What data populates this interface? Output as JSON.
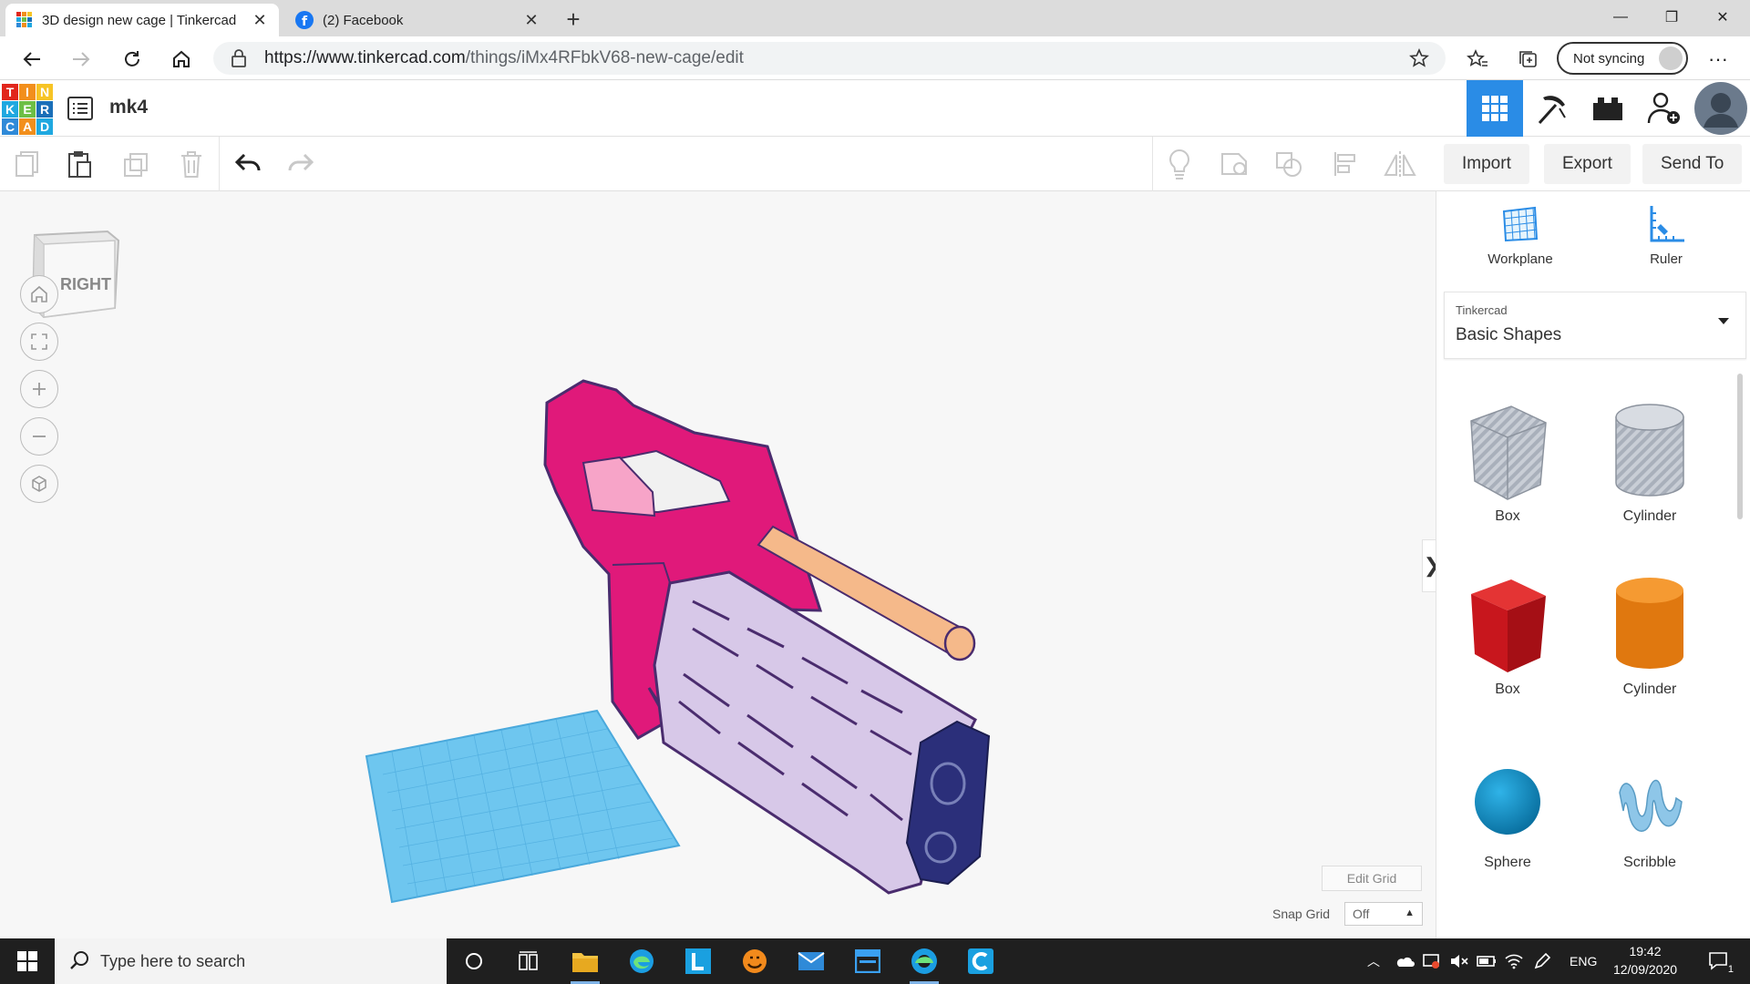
{
  "browser": {
    "tabs": [
      {
        "title": "3D design new cage | Tinkercad",
        "active": true
      },
      {
        "title": "(2) Facebook",
        "active": false
      }
    ],
    "url_host": "https://www.tinkercad.com",
    "url_path": "/things/iMx4RFbkV68-new-cage/edit",
    "sync_label": "Not syncing"
  },
  "app": {
    "logo_letters": [
      "T",
      "I",
      "N",
      "K",
      "E",
      "R",
      "C",
      "A",
      "D"
    ],
    "logo_colors": [
      "#e1261c",
      "#f28f1c",
      "#f7c425",
      "#1fa8e0",
      "#6dbf45",
      "#1a6fb8",
      "#2f8ad8",
      "#f28f1c",
      "#1fa8e0"
    ],
    "design_name": "mk4"
  },
  "toolbar": {
    "import_label": "Import",
    "export_label": "Export",
    "send_to_label": "Send To"
  },
  "viewport": {
    "view_cube_face": "RIGHT",
    "edit_grid_label": "Edit Grid",
    "snap_grid_label": "Snap Grid",
    "snap_grid_value": "Off"
  },
  "panel": {
    "workplane_label": "Workplane",
    "ruler_label": "Ruler",
    "library_source": "Tinkercad",
    "library_name": "Basic Shapes",
    "shapes": [
      {
        "label": "Box",
        "icon": "box-hole-icon"
      },
      {
        "label": "Cylinder",
        "icon": "cylinder-hole-icon"
      },
      {
        "label": "Box",
        "icon": "box-solid-icon"
      },
      {
        "label": "Cylinder",
        "icon": "cylinder-solid-icon"
      },
      {
        "label": "Sphere",
        "icon": "sphere-icon"
      },
      {
        "label": "Scribble",
        "icon": "scribble-icon"
      }
    ]
  },
  "colors": {
    "accent_blue": "#2a8ce6",
    "magenta_part": "#e0197a",
    "lavender_part": "#d7c8e8",
    "navy_part": "#2b2f7a",
    "barrel": "#f5b98a",
    "workplane": "#6ec6ef"
  },
  "taskbar": {
    "search_placeholder": "Type here to search",
    "language": "ENG",
    "time": "19:42",
    "date": "12/09/2020",
    "notification_count": "1"
  }
}
